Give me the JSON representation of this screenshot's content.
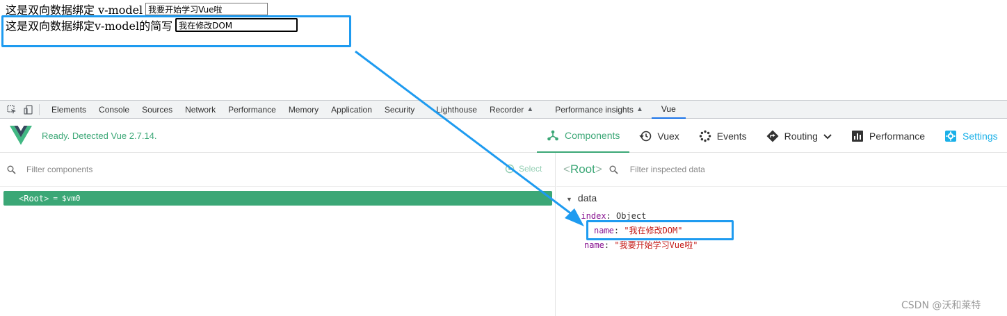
{
  "page": {
    "line1_label": "这是双向数据绑定 v-model",
    "line1_value": "我要开始学习Vue啦",
    "line2_label": "这是双向数据绑定v-model的简写",
    "line2_value": "我在修改DOM"
  },
  "devtools": {
    "tabs": [
      {
        "label": "Elements"
      },
      {
        "label": "Console"
      },
      {
        "label": "Sources"
      },
      {
        "label": "Network"
      },
      {
        "label": "Performance"
      },
      {
        "label": "Memory"
      },
      {
        "label": "Application"
      },
      {
        "label": "Security"
      },
      {
        "label": "Lighthouse"
      },
      {
        "label": "Recorder"
      },
      {
        "label": "Performance insights"
      },
      {
        "label": "Vue"
      }
    ]
  },
  "vue": {
    "status": "Ready. Detected Vue 2.7.14.",
    "nav": {
      "components": "Components",
      "vuex": "Vuex",
      "events": "Events",
      "routing": "Routing",
      "performance": "Performance",
      "settings": "Settings"
    },
    "filter_components_placeholder": "Filter components",
    "select_label": "Select",
    "root_tag_open": "<",
    "root_name": "Root",
    "root_tag_close": ">",
    "root_eq": "=",
    "root_vm": "$vm0",
    "inspected_title": "Root",
    "filter_data_placeholder": "Filter inspected data",
    "data_section": "data",
    "index_key": "index",
    "index_type": "Object",
    "index_name_key": "name",
    "index_name_value": "\"我在修改DOM\"",
    "name_key": "name",
    "name_value": "\"我要开始学习Vue啦\""
  },
  "watermark": "CSDN @沃和莱特",
  "colors": {
    "vue_green": "#3ba776",
    "annotation_blue": "#1e9bf0"
  }
}
